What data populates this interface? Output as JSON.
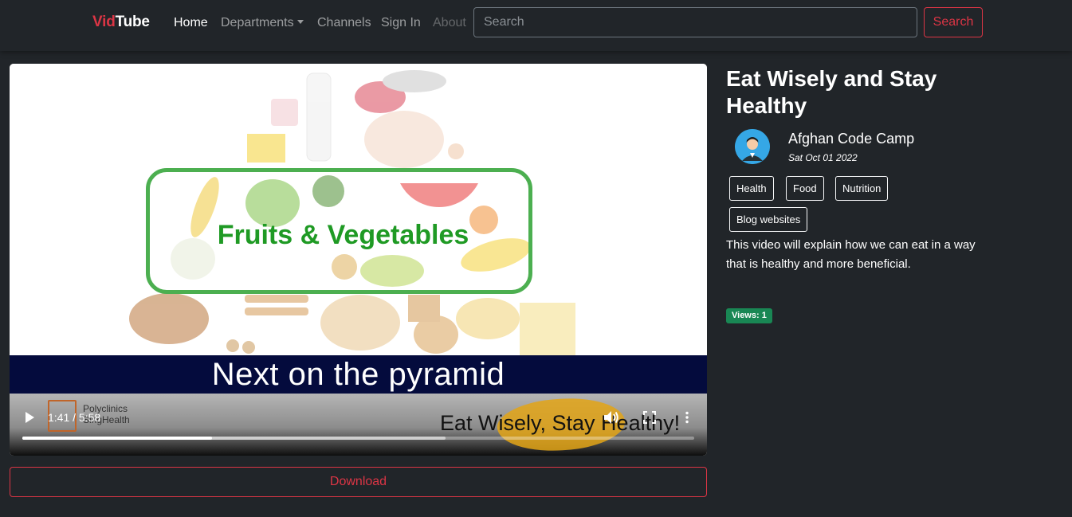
{
  "navbar": {
    "brand_part1": "Vid",
    "brand_part2": "Tube",
    "links": {
      "home": "Home",
      "departments": "Departments",
      "channels": "Channels",
      "signin": "Sign In",
      "about": "About"
    },
    "search_placeholder": "Search",
    "search_button": "Search"
  },
  "video": {
    "frame_headline": "Fruits & Vegetables",
    "frame_subtitle": "Next on the pyramid",
    "frame_logo_line1": "Polyclinics",
    "frame_logo_line2": "SingHealth",
    "frame_tagline": "Eat Wisely, Stay Healthy!",
    "time_display": "1:41 / 5:58",
    "played_fraction": 0.282,
    "buffered_fraction": 0.63,
    "play_icon": "play-icon",
    "volume_icon": "volume-icon",
    "fullscreen_icon": "fullscreen-icon",
    "more_icon": "more-vertical-icon"
  },
  "download_button": "Download",
  "details": {
    "title": "Eat Wisely and Stay Healthy",
    "channel": "Afghan Code Camp",
    "date": "Sat Oct 01 2022",
    "tags": [
      "Health",
      "Food",
      "Nutrition",
      "Blog websites"
    ],
    "description": "This video will explain how we can eat in a way that is healthy and more beneficial.",
    "views": "Views: 1"
  },
  "colors": {
    "background": "#212529",
    "accent_red": "#dc3545",
    "views_green": "#198754",
    "avatar_blue": "#35a7e6"
  }
}
